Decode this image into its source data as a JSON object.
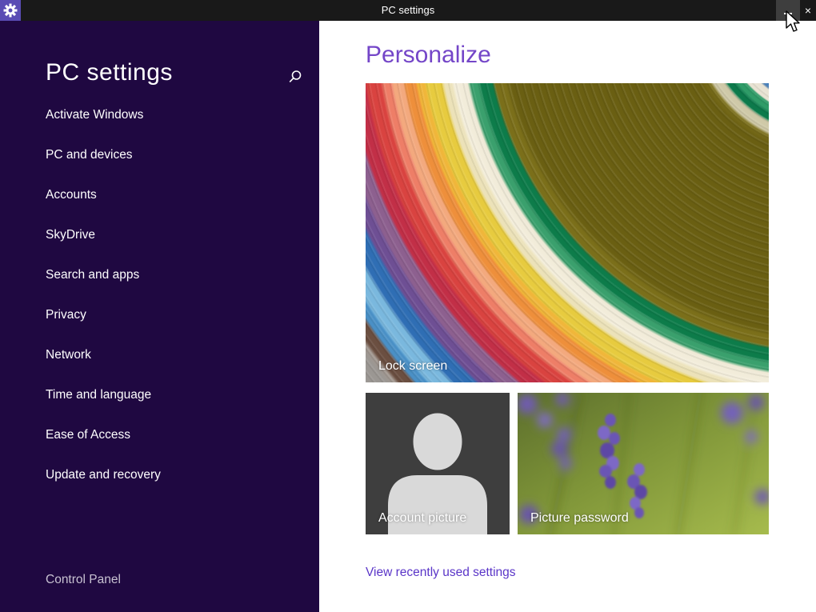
{
  "titlebar": {
    "title": "PC settings",
    "close_glyph": "×",
    "app_tile_color": "#5a4cb4",
    "bar_color": "#191919",
    "minimize_hover_color": "#3e3e3e"
  },
  "sidebar": {
    "title": "PC settings",
    "search_icon": "magnifier",
    "items": [
      "Activate Windows",
      "PC and devices",
      "Accounts",
      "SkyDrive",
      "Search and apps",
      "Privacy",
      "Network",
      "Time and language",
      "Ease of Access",
      "Update and recovery"
    ],
    "footer": "Control Panel",
    "bg_color": "#1f0841",
    "text_color": "#ffffff"
  },
  "main": {
    "heading": "Personalize",
    "heading_color": "#7446c8",
    "tiles": {
      "lock_screen": {
        "label": "Lock screen"
      },
      "account_picture": {
        "label": "Account picture"
      },
      "picture_password": {
        "label": "Picture password"
      }
    },
    "link": "View recently used settings",
    "link_color": "#5a35c8"
  }
}
